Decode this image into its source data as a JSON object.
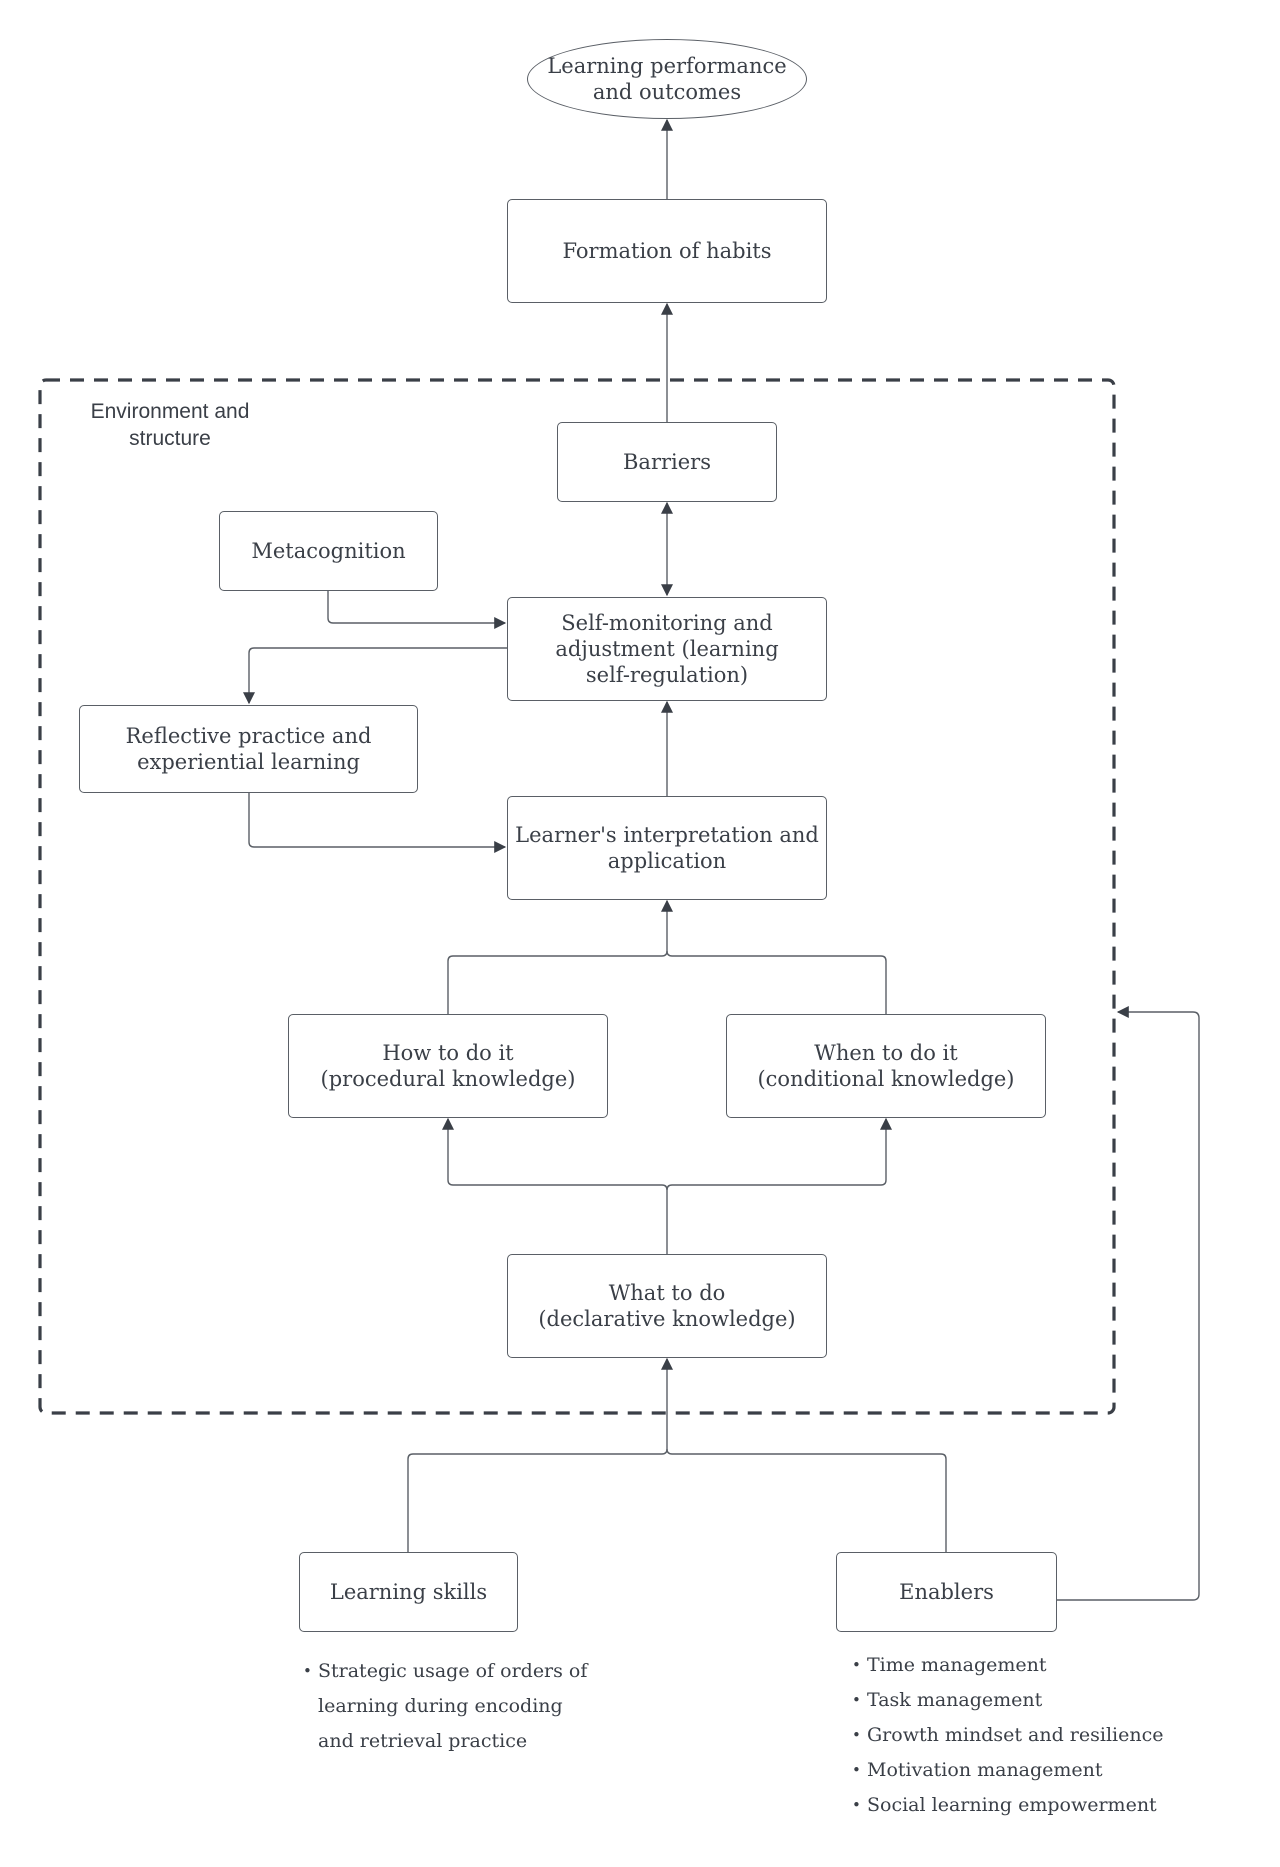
{
  "diagram": {
    "title_node": "Learning performance\nand outcomes",
    "container_label": "Environment and\nstructure",
    "nodes": {
      "outcomes": "Learning performance\nand outcomes",
      "habits": "Formation of habits",
      "barriers": "Barriers",
      "metacognition": "Metacognition",
      "self_monitoring": "Self-monitoring and\nadjustment (learning\nself-regulation)",
      "reflective": "Reflective practice and\nexperiential learning",
      "interpretation": "Learner's interpretation and\napplication",
      "procedural": "How to do it\n(procedural knowledge)",
      "conditional": "When to do it\n(conditional knowledge)",
      "declarative": "What to do\n(declarative knowledge)",
      "learning_skills": "Learning skills",
      "enablers": "Enablers"
    },
    "learning_skills_items": [
      "Strategic usage of orders of learning during encoding and retrieval practice"
    ],
    "enablers_items": [
      "Time management",
      "Task management",
      "Growth mindset and resilience",
      "Motivation management",
      "Social learning empowerment"
    ],
    "edges": [
      {
        "from": "habits",
        "to": "outcomes",
        "type": "arrow"
      },
      {
        "from": "barriers",
        "to": "habits",
        "type": "arrow"
      },
      {
        "from": "barriers",
        "to": "self_monitoring",
        "type": "bidirectional"
      },
      {
        "from": "metacognition",
        "to": "self_monitoring",
        "type": "arrow"
      },
      {
        "from": "self_monitoring",
        "to": "reflective",
        "type": "arrow"
      },
      {
        "from": "reflective",
        "to": "interpretation",
        "type": "arrow"
      },
      {
        "from": "interpretation",
        "to": "self_monitoring",
        "type": "arrow"
      },
      {
        "from": "procedural",
        "to": "interpretation",
        "type": "arrow"
      },
      {
        "from": "conditional",
        "to": "interpretation",
        "type": "arrow"
      },
      {
        "from": "declarative",
        "to": "procedural",
        "type": "arrow"
      },
      {
        "from": "declarative",
        "to": "conditional",
        "type": "arrow"
      },
      {
        "from": "learning_skills",
        "to": "declarative",
        "type": "arrow"
      },
      {
        "from": "enablers",
        "to": "declarative",
        "type": "arrow"
      },
      {
        "from": "enablers",
        "to": "environment_container",
        "type": "arrow"
      }
    ],
    "colors": {
      "stroke": "#5a5f66",
      "arrowhead": "#3a3f47",
      "dash": "#3a3f47",
      "text": "#3a3f47"
    }
  }
}
